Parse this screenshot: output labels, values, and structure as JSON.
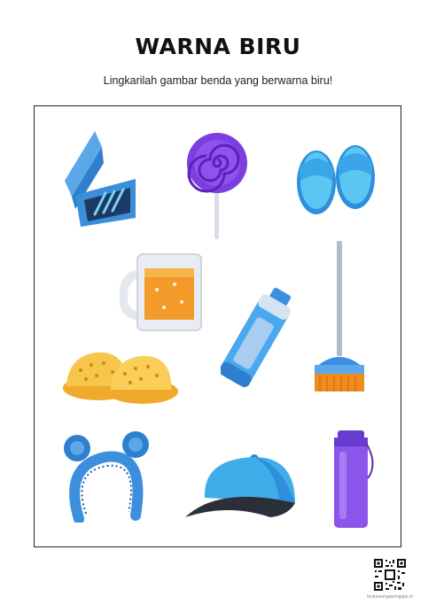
{
  "worksheet": {
    "title": "WARNA BIRU",
    "instruction": "Lingkarilah gambar benda yang berwarna biru!"
  },
  "items": [
    {
      "id": "pencil-case",
      "icon": "pencil-case-icon",
      "color": "#3a8fd8"
    },
    {
      "id": "lollipop",
      "icon": "lollipop-icon",
      "color": "#7b3fe0"
    },
    {
      "id": "sandals",
      "icon": "sandals-icon",
      "color": "#43b7ee"
    },
    {
      "id": "mug",
      "icon": "mug-icon",
      "color": "#f29b2a"
    },
    {
      "id": "tumbler",
      "icon": "tumbler-icon",
      "color": "#3c8fe0"
    },
    {
      "id": "broom",
      "icon": "broom-icon",
      "color": "#f08b1e"
    },
    {
      "id": "clogs",
      "icon": "clogs-icon",
      "color": "#f6c54a"
    },
    {
      "id": "headband",
      "icon": "headband-icon",
      "color": "#3b8fdc"
    },
    {
      "id": "cap",
      "icon": "cap-icon",
      "color": "#3faee8"
    },
    {
      "id": "bottle",
      "icon": "bottle-icon",
      "color": "#8a55e8"
    }
  ],
  "footer": {
    "qr_icon": "qr-code-icon",
    "caption": "lenturwangepengajar.id"
  }
}
